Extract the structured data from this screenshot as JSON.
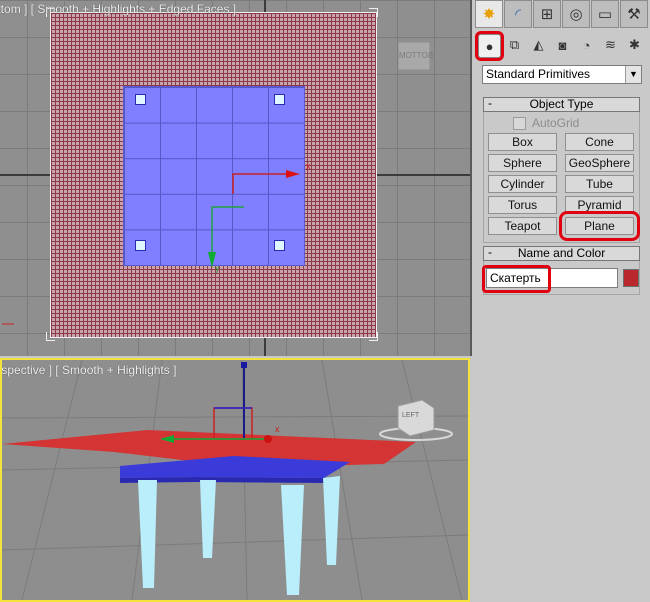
{
  "viewports": {
    "top": {
      "label": "[ Bottom ] [ Smooth + Highlights + Edged Faces ]",
      "cube_label": "BOTTOM"
    },
    "perspective": {
      "label": "[ Perspective ] [ Smooth + Highlights ]",
      "cube_label": "LEFT"
    }
  },
  "gizmo": {
    "x_label": "x",
    "y_label": "y"
  },
  "command_panel": {
    "tabs": [
      "create-tab",
      "modify-tab",
      "hierarchy-tab",
      "motion-tab",
      "display-tab",
      "utilities-tab"
    ],
    "subtabs": [
      "geometry",
      "shapes",
      "lights",
      "cameras",
      "helpers",
      "space-warps",
      "systems"
    ],
    "category_dropdown": "Standard Primitives",
    "object_type": {
      "title": "Object Type",
      "autogrid_label": "AutoGrid",
      "buttons": [
        "Box",
        "Cone",
        "Sphere",
        "GeoSphere",
        "Cylinder",
        "Tube",
        "Torus",
        "Pyramid",
        "Teapot",
        "Plane"
      ]
    },
    "name_and_color": {
      "title": "Name and Color",
      "name_value": "Скатерть",
      "color": "#b8282d"
    },
    "minus_sign": "-"
  },
  "colors": {
    "highlight": "#e00010",
    "viewport_active_border": "#f3e33a",
    "tablecloth": "#d43434",
    "tabletop": "#3b3bd9",
    "legs": "#b9eefa"
  }
}
